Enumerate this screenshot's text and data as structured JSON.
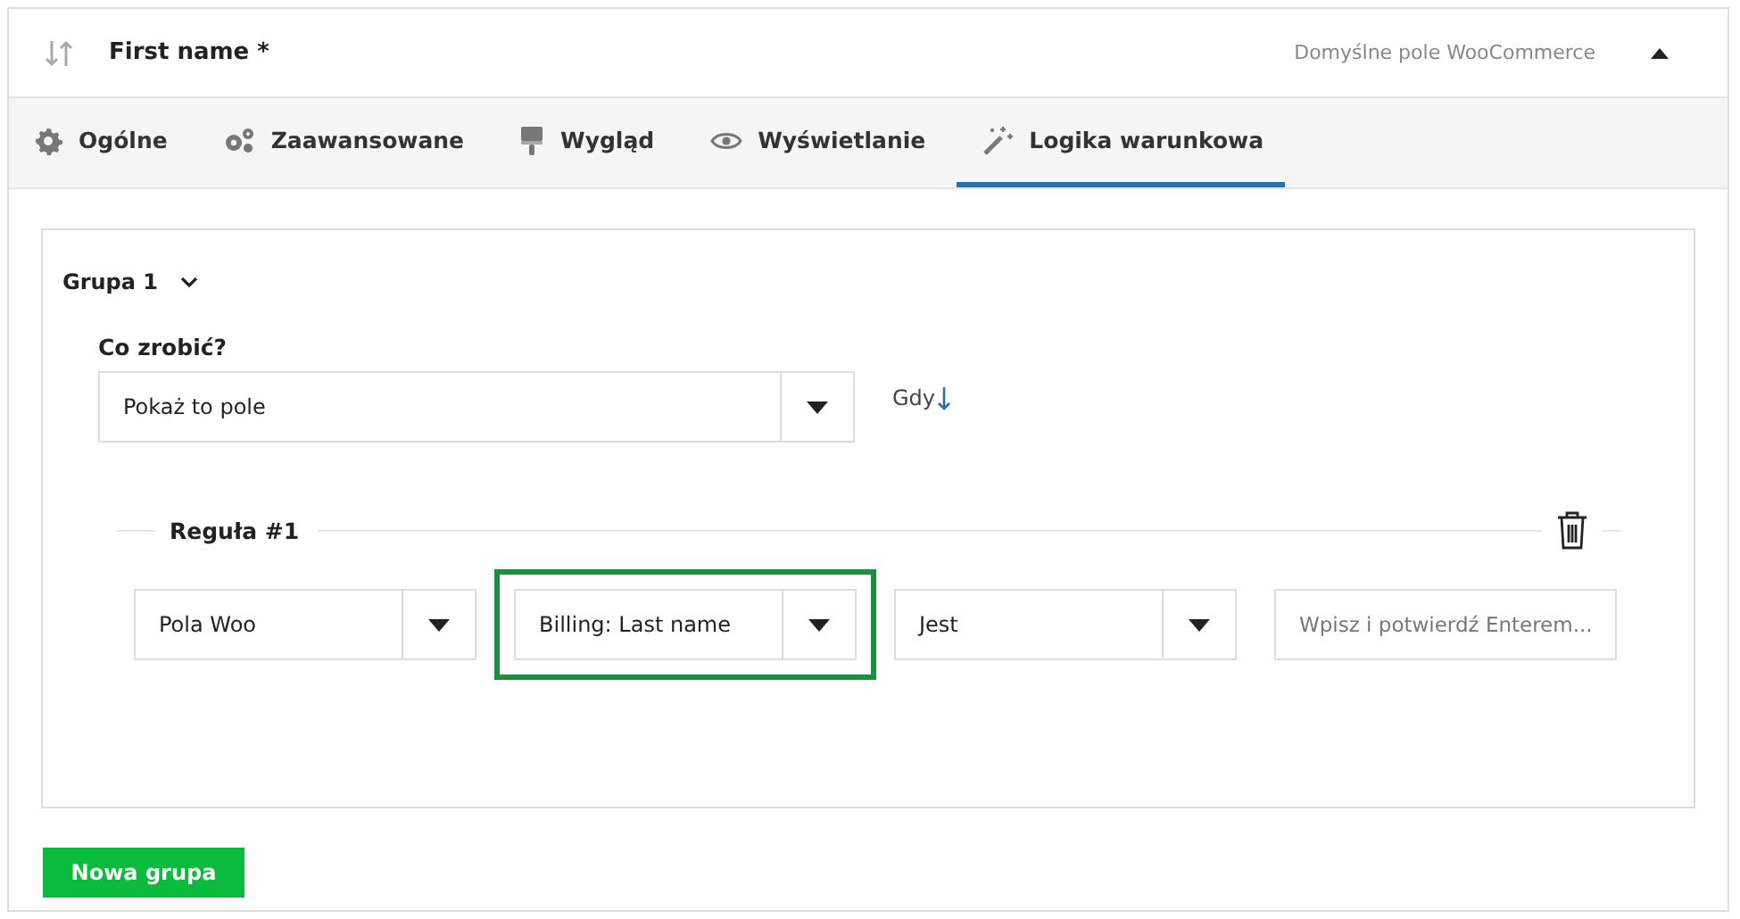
{
  "header": {
    "title": "First name *",
    "source": "Domyślne pole WooCommerce",
    "expanded": true
  },
  "tabs": [
    {
      "label": "Ogólne",
      "kind": "gear",
      "selected": false
    },
    {
      "label": "Zaawansowane",
      "kind": "gears",
      "selected": false
    },
    {
      "label": "Wygląd",
      "kind": "brush",
      "selected": false
    },
    {
      "label": "Wyświetlanie",
      "kind": "eye",
      "selected": false
    },
    {
      "label": "Logika warunkowa",
      "kind": "wand",
      "selected": true
    }
  ],
  "group": {
    "title": "Grupa 1",
    "expanded": true,
    "action_label": "Co zrobić?",
    "action_value": "Pokaż to pole",
    "when_label": "Gdy",
    "rule": {
      "title": "Reguła #1",
      "selects": [
        {
          "value": "Pola Woo",
          "highlighted": false
        },
        {
          "value": "Billing: Last name",
          "highlighted": true
        },
        {
          "value": "Jest",
          "highlighted": false
        }
      ],
      "placeholder": "Wpisz i potwierdź Enterem..."
    }
  },
  "new_group_button": "Nowa grupa"
}
